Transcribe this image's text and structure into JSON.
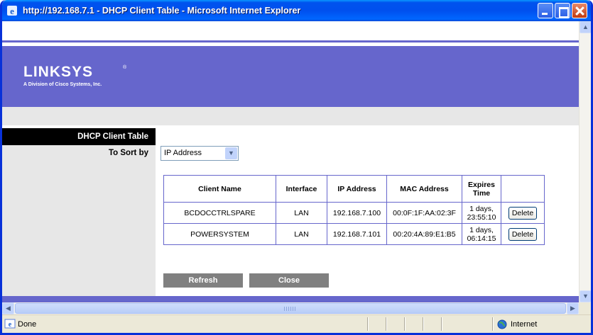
{
  "window": {
    "title": "http://192.168.7.1 - DHCP Client Table - Microsoft Internet Explorer"
  },
  "header": {
    "logo_text": "LINKSYS",
    "logo_reg": "®",
    "logo_subtitle": "A Division of Cisco Systems, Inc.",
    "color": "#6666cc"
  },
  "page": {
    "section_title": "DHCP Client Table",
    "sort_label": "To Sort by",
    "sort_value": "IP Address"
  },
  "table": {
    "columns": [
      "Client Name",
      "Interface",
      "IP Address",
      "MAC Address",
      "Expires Time",
      ""
    ],
    "rows": [
      {
        "client_name": "BCDOCCTRLSPARE",
        "interface": "LAN",
        "ip": "192.168.7.100",
        "mac": "00:0F:1F:AA:02:3F",
        "expires_1": "1 days,",
        "expires_2": "23:55:10",
        "action": "Delete"
      },
      {
        "client_name": "POWERSYSTEM",
        "interface": "LAN",
        "ip": "192.168.7.101",
        "mac": "00:20:4A:89:E1:B5",
        "expires_1": "1 days,",
        "expires_2": "06:14:15",
        "action": "Delete"
      }
    ]
  },
  "buttons": {
    "refresh": "Refresh",
    "close": "Close"
  },
  "status": {
    "left": "Done",
    "zone": "Internet"
  }
}
